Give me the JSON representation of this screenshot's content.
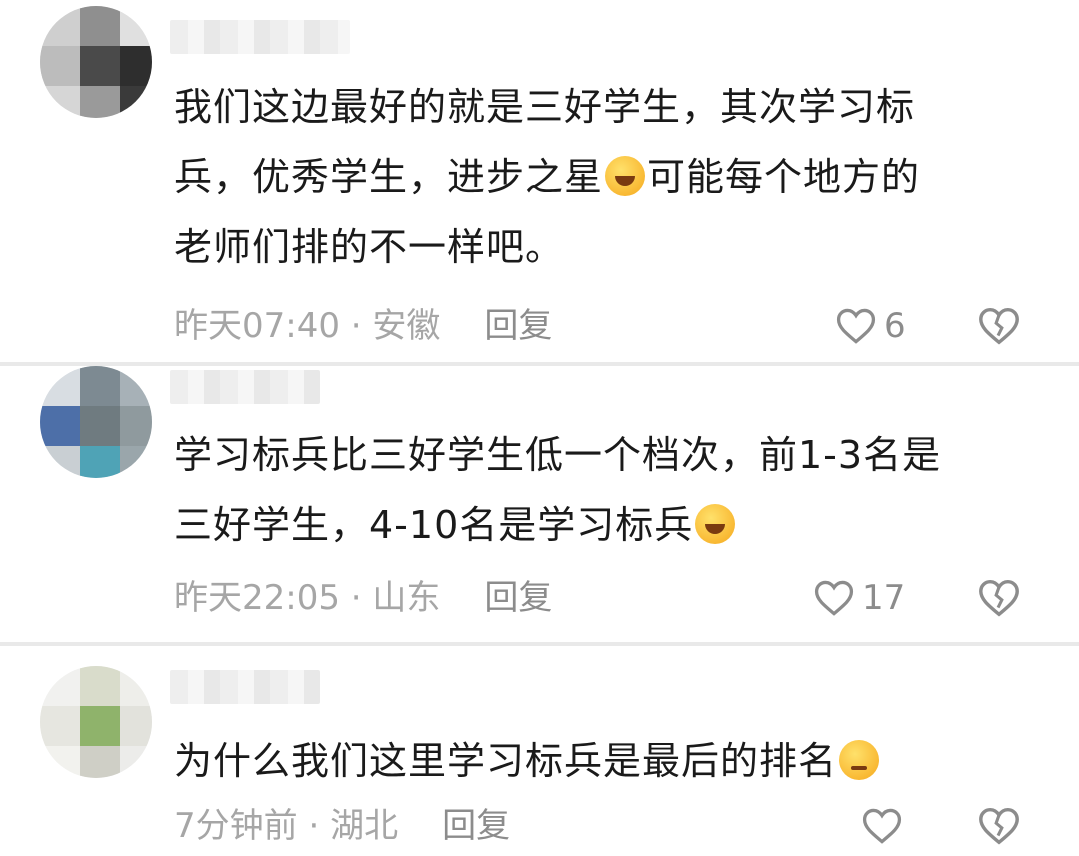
{
  "comments": [
    {
      "text_lines": [
        "我们这边最好的就是三好学生，其次学习标",
        "兵，优秀学生，进步之星",
        "可能每个地方的",
        "老师们排的不一样吧。"
      ],
      "time": "昨天07:40",
      "location": "安徽",
      "reply_label": "回复",
      "likes": "6"
    },
    {
      "text_lines": [
        "学习标兵比三好学生低一个档次，前1-3名是",
        "三好学生，4-10名是学习标兵"
      ],
      "time": "昨天22:05",
      "location": "山东",
      "reply_label": "回复",
      "likes": "17"
    },
    {
      "text_lines": [
        "为什么我们这里学习标兵是最后的排名"
      ],
      "time": "7分钟前",
      "location": "湖北",
      "reply_label": "回复",
      "likes": ""
    }
  ],
  "separator": " · ",
  "icons": {
    "like": "heart-outline-icon",
    "dislike": "broken-heart-icon",
    "emoji_laugh": "laughing-tears-emoji",
    "emoji_think": "thinking-glasses-emoji"
  },
  "colors": {
    "text": "#1a1a1a",
    "meta": "#a6a6a6",
    "icon": "#8c8c8c",
    "divider": "#e9e9e9"
  }
}
